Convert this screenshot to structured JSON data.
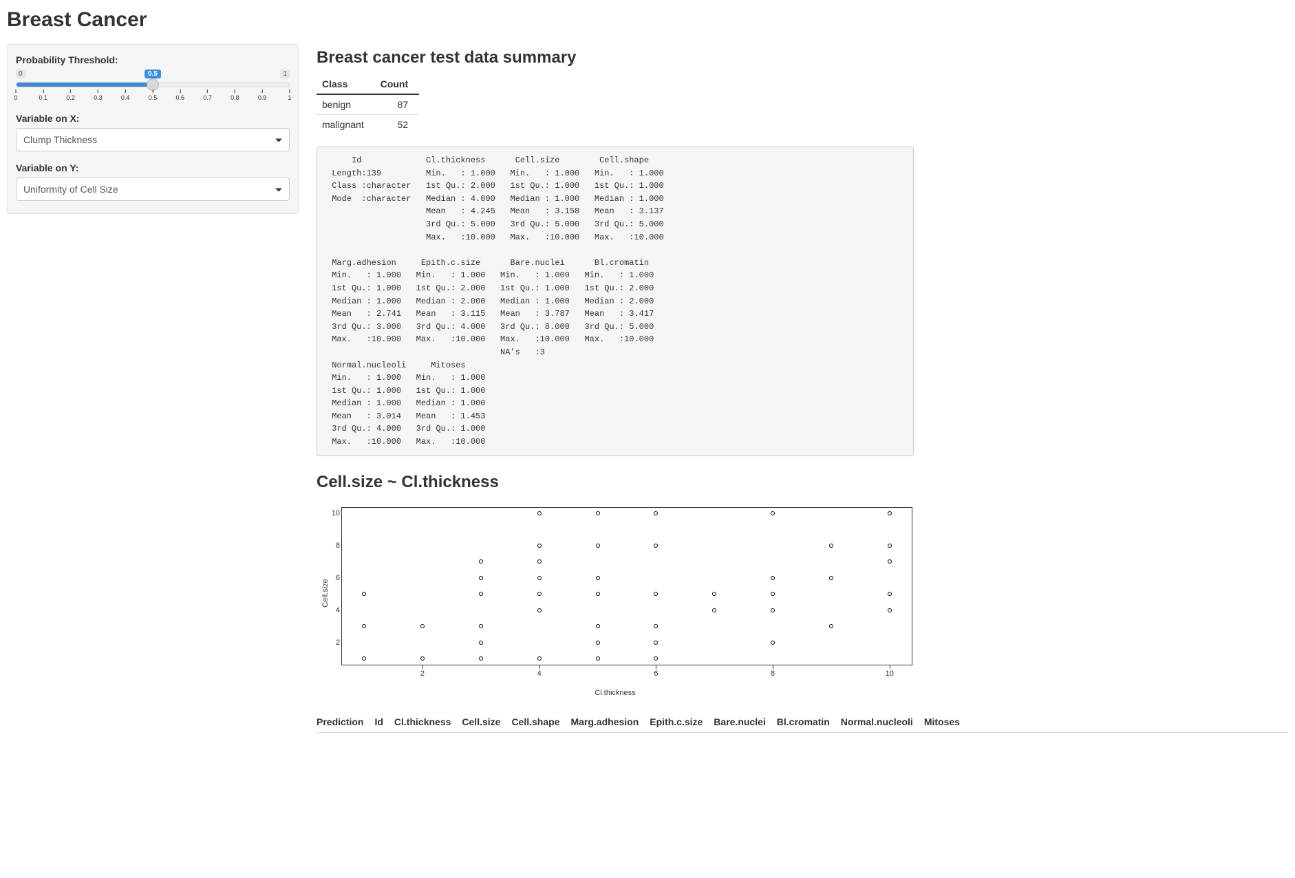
{
  "title": "Breast Cancer",
  "sidebar": {
    "threshold_label": "Probability Threshold:",
    "threshold_min": "0",
    "threshold_max": "1",
    "threshold_value": "0.5",
    "threshold_ticks": [
      "0",
      "0.1",
      "0.2",
      "0.3",
      "0.4",
      "0.5",
      "0.6",
      "0.7",
      "0.8",
      "0.9",
      "1"
    ],
    "var_x_label": "Variable on X:",
    "var_x_value": "Clump Thickness",
    "var_y_label": "Variable on Y:",
    "var_y_value": "Uniformity of Cell Size"
  },
  "summary_title": "Breast cancer test data summary",
  "class_table": {
    "headers": [
      "Class",
      "Count"
    ],
    "rows": [
      {
        "class": "benign",
        "count": "87"
      },
      {
        "class": "malignant",
        "count": "52"
      }
    ]
  },
  "summary_text": "     Id             Cl.thickness      Cell.size        Cell.shape    \n Length:139         Min.   : 1.000   Min.   : 1.000   Min.   : 1.000  \n Class :character   1st Qu.: 2.000   1st Qu.: 1.000   1st Qu.: 1.000  \n Mode  :character   Median : 4.000   Median : 1.000   Median : 1.000  \n                    Mean   : 4.245   Mean   : 3.158   Mean   : 3.137  \n                    3rd Qu.: 5.000   3rd Qu.: 5.000   3rd Qu.: 5.000  \n                    Max.   :10.000   Max.   :10.000   Max.   :10.000  \n                                                                      \n Marg.adhesion     Epith.c.size      Bare.nuclei      Bl.cromatin    \n Min.   : 1.000   Min.   : 1.000   Min.   : 1.000   Min.   : 1.000  \n 1st Qu.: 1.000   1st Qu.: 2.000   1st Qu.: 1.000   1st Qu.: 2.000  \n Median : 1.000   Median : 2.000   Median : 1.000   Median : 2.000  \n Mean   : 2.741   Mean   : 3.115   Mean   : 3.787   Mean   : 3.417  \n 3rd Qu.: 3.000   3rd Qu.: 4.000   3rd Qu.: 8.000   3rd Qu.: 5.000  \n Max.   :10.000   Max.   :10.000   Max.   :10.000   Max.   :10.000  \n                                   NA's   :3                        \n Normal.nucleoli     Mitoses      \n Min.   : 1.000   Min.   : 1.000  \n 1st Qu.: 1.000   1st Qu.: 1.000  \n Median : 1.000   Median : 1.000  \n Mean   : 3.014   Mean   : 1.453  \n 3rd Qu.: 4.000   3rd Qu.: 1.000  \n Max.   :10.000   Max.   :10.000  ",
  "plot_title": "Cell.size ~ Cl.thickness",
  "chart_data": {
    "type": "scatter",
    "xlabel": "Cl.thickness",
    "ylabel": "Cell.size",
    "xlim": [
      1,
      10
    ],
    "ylim": [
      1,
      10
    ],
    "xticks": [
      2,
      4,
      6,
      8,
      10
    ],
    "yticks": [
      2,
      4,
      6,
      8,
      10
    ],
    "points": [
      [
        1,
        1
      ],
      [
        2,
        1
      ],
      [
        3,
        1
      ],
      [
        4,
        1
      ],
      [
        5,
        1
      ],
      [
        6,
        1
      ],
      [
        3,
        2
      ],
      [
        5,
        2
      ],
      [
        6,
        2
      ],
      [
        8,
        2
      ],
      [
        1,
        3
      ],
      [
        2,
        3
      ],
      [
        3,
        3
      ],
      [
        5,
        3
      ],
      [
        6,
        3
      ],
      [
        9,
        3
      ],
      [
        4,
        4
      ],
      [
        7,
        4
      ],
      [
        8,
        4
      ],
      [
        10,
        4
      ],
      [
        1,
        5
      ],
      [
        3,
        5
      ],
      [
        4,
        5
      ],
      [
        5,
        5
      ],
      [
        6,
        5
      ],
      [
        7,
        5
      ],
      [
        8,
        5
      ],
      [
        10,
        5
      ],
      [
        3,
        6
      ],
      [
        4,
        6
      ],
      [
        5,
        6
      ],
      [
        8,
        6
      ],
      [
        9,
        6
      ],
      [
        3,
        7
      ],
      [
        4,
        7
      ],
      [
        10,
        7
      ],
      [
        4,
        8
      ],
      [
        5,
        8
      ],
      [
        6,
        8
      ],
      [
        9,
        8
      ],
      [
        10,
        8
      ],
      [
        4,
        10
      ],
      [
        5,
        10
      ],
      [
        6,
        10
      ],
      [
        8,
        10
      ],
      [
        10,
        10
      ]
    ]
  },
  "pred_headers": [
    "Prediction",
    "Id",
    "Cl.thickness",
    "Cell.size",
    "Cell.shape",
    "Marg.adhesion",
    "Epith.c.size",
    "Bare.nuclei",
    "Bl.cromatin",
    "Normal.nucleoli",
    "Mitoses"
  ]
}
